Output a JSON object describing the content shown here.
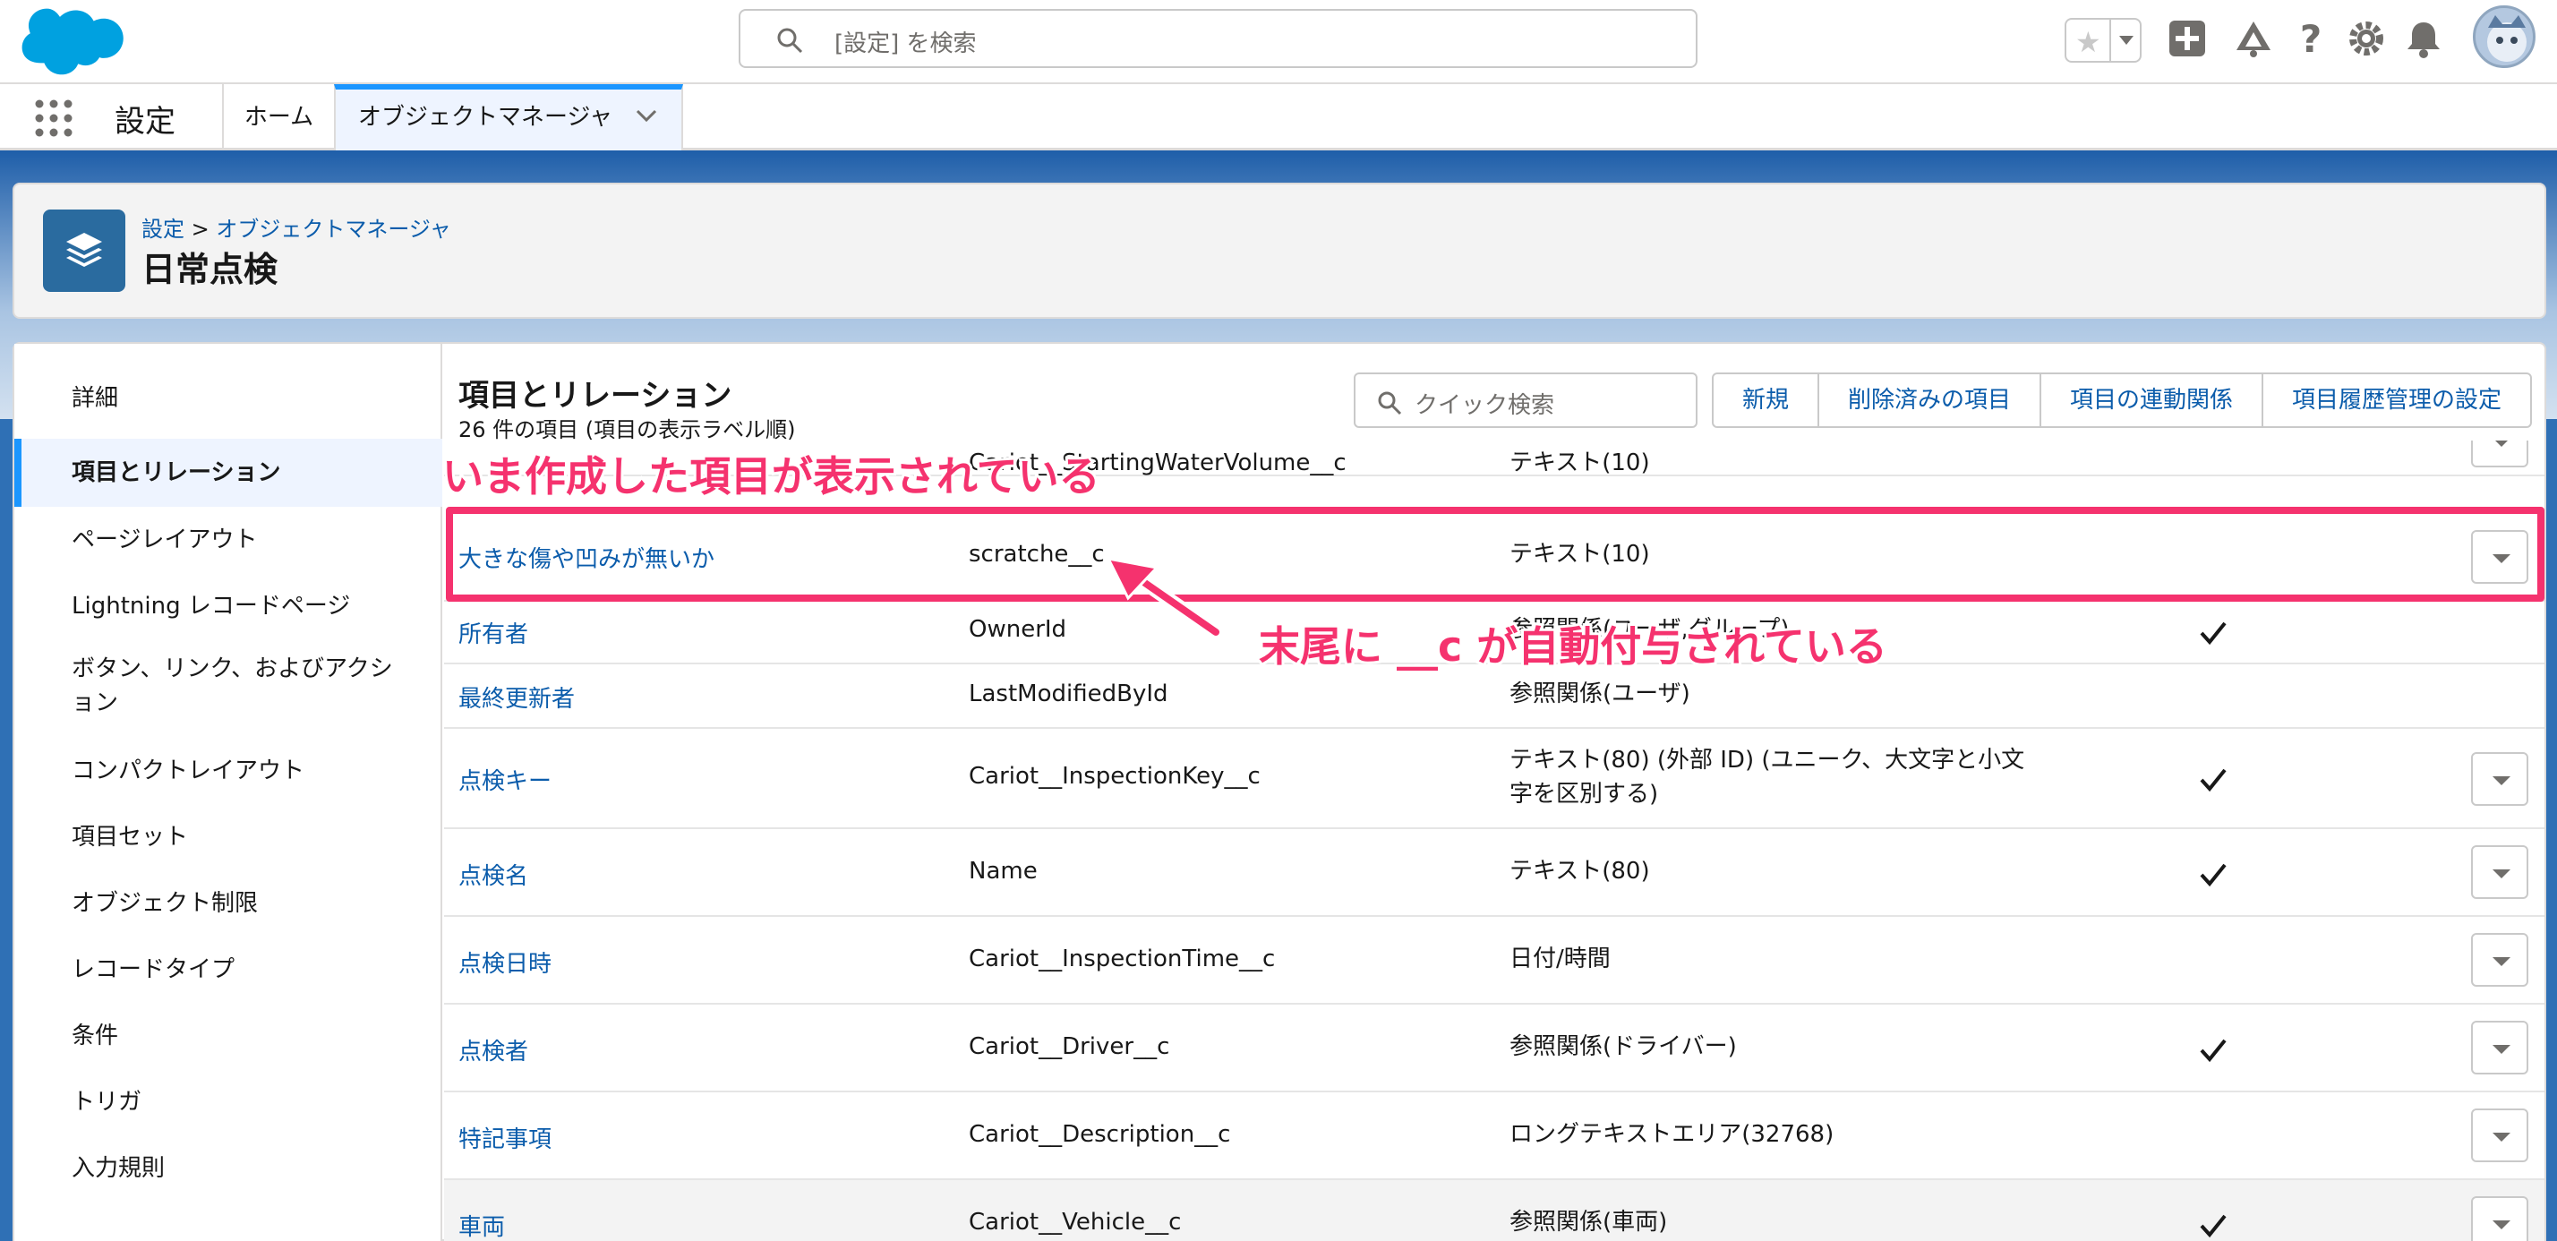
{
  "header": {
    "search_placeholder": "[設定] を検索",
    "icons": [
      "star-icon",
      "add-icon",
      "trailhead-icon",
      "help-icon",
      "gear-icon",
      "bell-icon",
      "avatar"
    ]
  },
  "app_nav": {
    "app_name": "設定",
    "tabs": [
      {
        "label": "ホーム"
      },
      {
        "label": "オブジェクトマネージャ"
      }
    ]
  },
  "object_header": {
    "breadcrumb_setup": "設定",
    "breadcrumb_sep": ">",
    "breadcrumb_om": "オブジェクトマネージャ",
    "title": "日常点検"
  },
  "sidebar": {
    "items": [
      {
        "label": "詳細"
      },
      {
        "label": "項目とリレーション"
      },
      {
        "label": "ページレイアウト"
      },
      {
        "label": "Lightning レコードページ"
      },
      {
        "label": "ボタン、リンク、およびアクション"
      },
      {
        "label": "コンパクトレイアウト"
      },
      {
        "label": "項目セット"
      },
      {
        "label": "オブジェクト制限"
      },
      {
        "label": "レコードタイプ"
      },
      {
        "label": "条件"
      },
      {
        "label": "トリガ"
      },
      {
        "label": "入力規則"
      }
    ]
  },
  "main": {
    "title": "項目とリレーション",
    "subtitle": "26 件の項目 (項目の表示ラベル順)",
    "quick_search_placeholder": "クイック検索",
    "buttons": [
      {
        "label": "新規"
      },
      {
        "label": "削除済みの項目"
      },
      {
        "label": "項目の連動関係"
      },
      {
        "label": "項目履歴管理の設定"
      }
    ]
  },
  "table": {
    "rows": [
      {
        "label": "",
        "api": "Cariot__StartingWaterVolume__c",
        "type": "テキスト(10)",
        "indexed": false,
        "menu": true
      },
      {
        "label": "大きな傷や凹みが無いか",
        "api": "scratche__c",
        "type": "テキスト(10)",
        "indexed": false,
        "menu": true
      },
      {
        "label": "所有者",
        "api": "OwnerId",
        "type": "参照関係(ユーザ,グループ)",
        "indexed": true,
        "menu": false
      },
      {
        "label": "最終更新者",
        "api": "LastModifiedById",
        "type": "参照関係(ユーザ)",
        "indexed": false,
        "menu": false
      },
      {
        "label": "点検キー",
        "api": "Cariot__InspectionKey__c",
        "type": "テキスト(80) (外部 ID) (ユニーク、大文字と小文字を区別する)",
        "indexed": true,
        "menu": true
      },
      {
        "label": "点検名",
        "api": "Name",
        "type": "テキスト(80)",
        "indexed": true,
        "menu": true
      },
      {
        "label": "点検日時",
        "api": "Cariot__InspectionTime__c",
        "type": "日付/時間",
        "indexed": false,
        "menu": true
      },
      {
        "label": "点検者",
        "api": "Cariot__Driver__c",
        "type": "参照関係(ドライバー)",
        "indexed": true,
        "menu": true
      },
      {
        "label": "特記事項",
        "api": "Cariot__Description__c",
        "type": "ロングテキストエリア(32768)",
        "indexed": false,
        "menu": true
      },
      {
        "label": "車両",
        "api": "Cariot__Vehicle__c",
        "type": "参照関係(車両)",
        "indexed": true,
        "menu": true
      }
    ]
  },
  "annotations": {
    "top_note": "いま作成した項目が表示されている",
    "arrow_note": "末尾に __c が自動付与されている",
    "color": "#f5326e"
  },
  "colors": {
    "brand_blue": "#1b96ff",
    "link_blue": "#0b5cab",
    "object_icon": "#2a6b9f"
  }
}
